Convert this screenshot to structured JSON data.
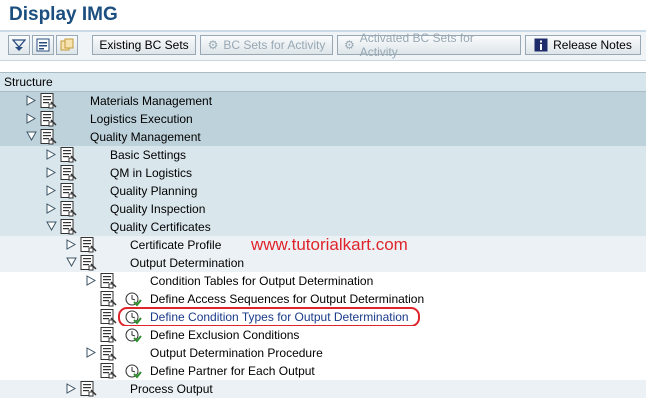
{
  "window": {
    "title": "Display IMG"
  },
  "toolbar": {
    "existing": "Existing BC Sets",
    "bc_activity": "BC Sets for Activity",
    "activated": "Activated BC Sets for Activity",
    "release_notes": "Release Notes"
  },
  "structure": {
    "header": "Structure",
    "rows": [
      {
        "label": "Materials Management",
        "level": 0,
        "expander": "collapsed"
      },
      {
        "label": "Logistics Execution",
        "level": 0,
        "expander": "collapsed"
      },
      {
        "label": "Quality Management",
        "level": 0,
        "expander": "expanded"
      },
      {
        "label": "Basic Settings",
        "level": 1,
        "expander": "collapsed"
      },
      {
        "label": "QM in Logistics",
        "level": 1,
        "expander": "collapsed"
      },
      {
        "label": "Quality Planning",
        "level": 1,
        "expander": "collapsed"
      },
      {
        "label": "Quality Inspection",
        "level": 1,
        "expander": "collapsed"
      },
      {
        "label": "Quality Certificates",
        "level": 1,
        "expander": "expanded"
      },
      {
        "label": "Certificate Profile",
        "level": 2,
        "expander": "collapsed"
      },
      {
        "label": "Output Determination",
        "level": 2,
        "expander": "expanded"
      },
      {
        "label": "Condition Tables for Output Determination",
        "level": 3,
        "expander": "collapsed"
      },
      {
        "label": "Define Access Sequences for Output Determination",
        "level": 3,
        "expander": "none",
        "activity": true
      },
      {
        "label": "Define Condition Types for Output Determination",
        "level": 3,
        "expander": "none",
        "activity": true,
        "selected": true
      },
      {
        "label": "Define Exclusion Conditions",
        "level": 3,
        "expander": "none",
        "activity": true
      },
      {
        "label": "Output Determination Procedure",
        "level": 3,
        "expander": "collapsed"
      },
      {
        "label": "Define Partner for Each Output",
        "level": 3,
        "expander": "none",
        "activity": true
      },
      {
        "label": "Process Output",
        "level": 2,
        "expander": "collapsed"
      }
    ]
  },
  "watermark": "www.tutorialkart.com",
  "colors": {
    "title": "#1c4f7f",
    "level0_bg": "#bed2db",
    "level1_bg": "#d9e6ec",
    "level2_bg": "#ebf1f4",
    "level3_bg": "#ffffff",
    "highlight": "#e0242b",
    "selected_text": "#1a3a8a"
  }
}
